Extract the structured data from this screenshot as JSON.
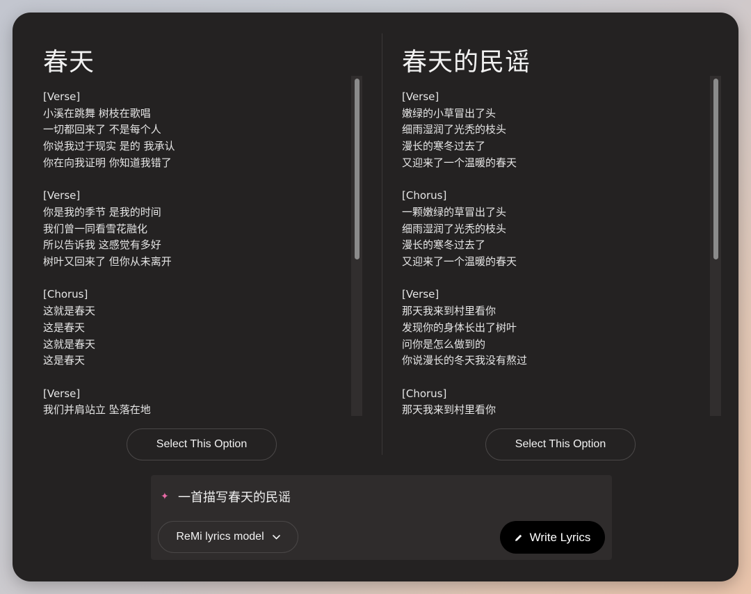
{
  "left_option": {
    "title": "春天",
    "lyrics": "[Verse]\n小溪在跳舞 树枝在歌唱\n一切都回来了 不是每个人\n你说我过于现实 是的 我承认\n你在向我证明 你知道我错了\n\n[Verse]\n你是我的季节 是我的时间\n我们曾一同看雪花融化\n所以告诉我 这感觉有多好\n树叶又回来了 但你从未离开\n\n[Chorus]\n这就是春天\n这是春天\n这就是春天\n这是春天\n\n[Verse]\n我们并肩站立 坠落在地",
    "select_label": "Select This Option",
    "scroll_position": 0.0
  },
  "right_option": {
    "title": "春天的民谣",
    "lyrics": "[Verse]\n嫩绿的小草冒出了头\n细雨湿润了光秃的枝头\n漫长的寒冬过去了\n又迎来了一个温暖的春天\n\n[Chorus]\n一颗嫩绿的草冒出了头\n细雨湿润了光秃的枝头\n漫长的寒冬过去了\n又迎来了一个温暖的春天\n\n[Verse]\n那天我来到村里看你\n发现你的身体长出了树叶\n问你是怎么做到的\n你说漫长的冬天我没有熬过\n\n[Chorus]\n那天我来到村里看你",
    "select_label": "Select This Option",
    "scroll_position": 0.0
  },
  "composer": {
    "prompt": "一首描写春天的民谣",
    "prompt_icon": "sparkle-icon",
    "model_label": "ReMi lyrics model",
    "model_icon": "chevron-down-icon",
    "write_label": "Write Lyrics",
    "write_icon": "pencil-icon",
    "accent_color": "#e86aa6"
  }
}
